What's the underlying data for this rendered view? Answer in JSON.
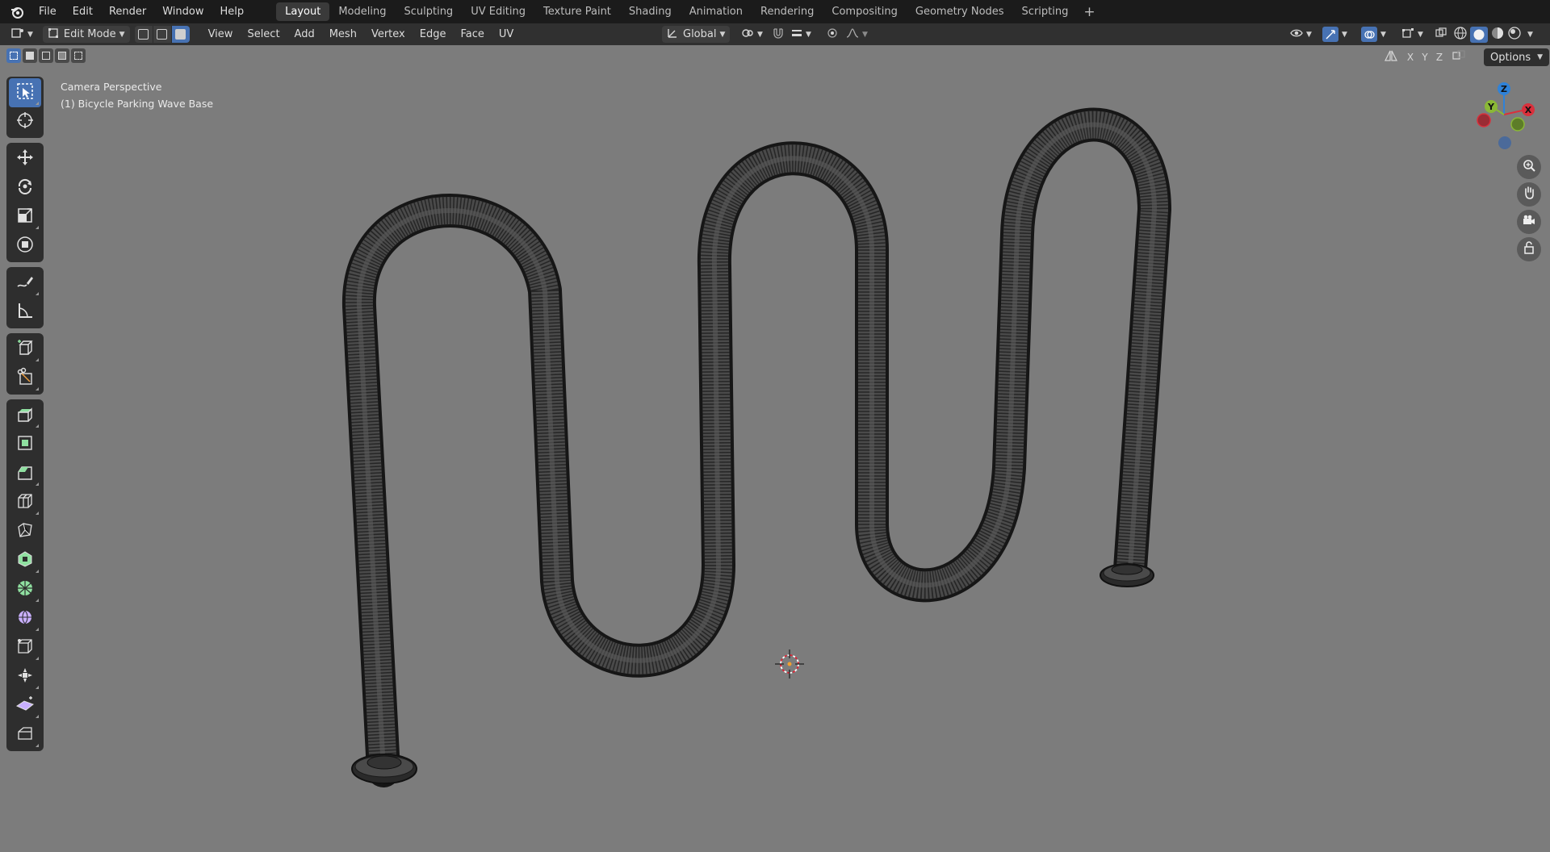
{
  "menu": {
    "items": [
      "File",
      "Edit",
      "Render",
      "Window",
      "Help"
    ]
  },
  "workspaces": {
    "tabs": [
      "Layout",
      "Modeling",
      "Sculpting",
      "UV Editing",
      "Texture Paint",
      "Shading",
      "Animation",
      "Rendering",
      "Compositing",
      "Geometry Nodes",
      "Scripting"
    ],
    "active": "Layout",
    "add_label": "+"
  },
  "header": {
    "mode_label": "Edit Mode",
    "menus": [
      "View",
      "Select",
      "Add",
      "Mesh",
      "Vertex",
      "Edge",
      "Face",
      "UV"
    ],
    "orientation_label": "Global"
  },
  "tool_settings": {
    "axis_labels": [
      "X",
      "Y",
      "Z"
    ],
    "options_label": "Options"
  },
  "viewport": {
    "view_name": "Camera Perspective",
    "object_name": "(1) Bicycle Parking Wave Base"
  },
  "gizmo": {
    "axis_x": "X",
    "axis_y": "Y",
    "axis_z": "Z",
    "colors": {
      "x": "#d9303c",
      "y": "#8ab836",
      "z": "#2f82d8"
    }
  },
  "icons": {
    "toolbar": [
      "select-box-icon",
      "cursor-icon",
      "move-icon",
      "rotate-icon",
      "scale-icon",
      "transform-icon",
      "annotate-icon",
      "measure-icon",
      "add-cube-icon",
      "knife-icon",
      "extrude-icon",
      "inset-icon",
      "bevel-icon",
      "loop-cut-icon",
      "poly-build-icon",
      "spin-icon",
      "smooth-icon",
      "edge-slide-icon",
      "shrink-fatten-icon",
      "shear-icon",
      "rip-icon"
    ],
    "nav": [
      "zoom-icon",
      "pan-hand-icon",
      "camera-icon",
      "lock-icon"
    ]
  },
  "theme": {
    "accent": "#4772b3",
    "viewport_bg": "#7c7c7c",
    "topbar_bg": "#1b1b1b",
    "header_bg": "#303030"
  }
}
